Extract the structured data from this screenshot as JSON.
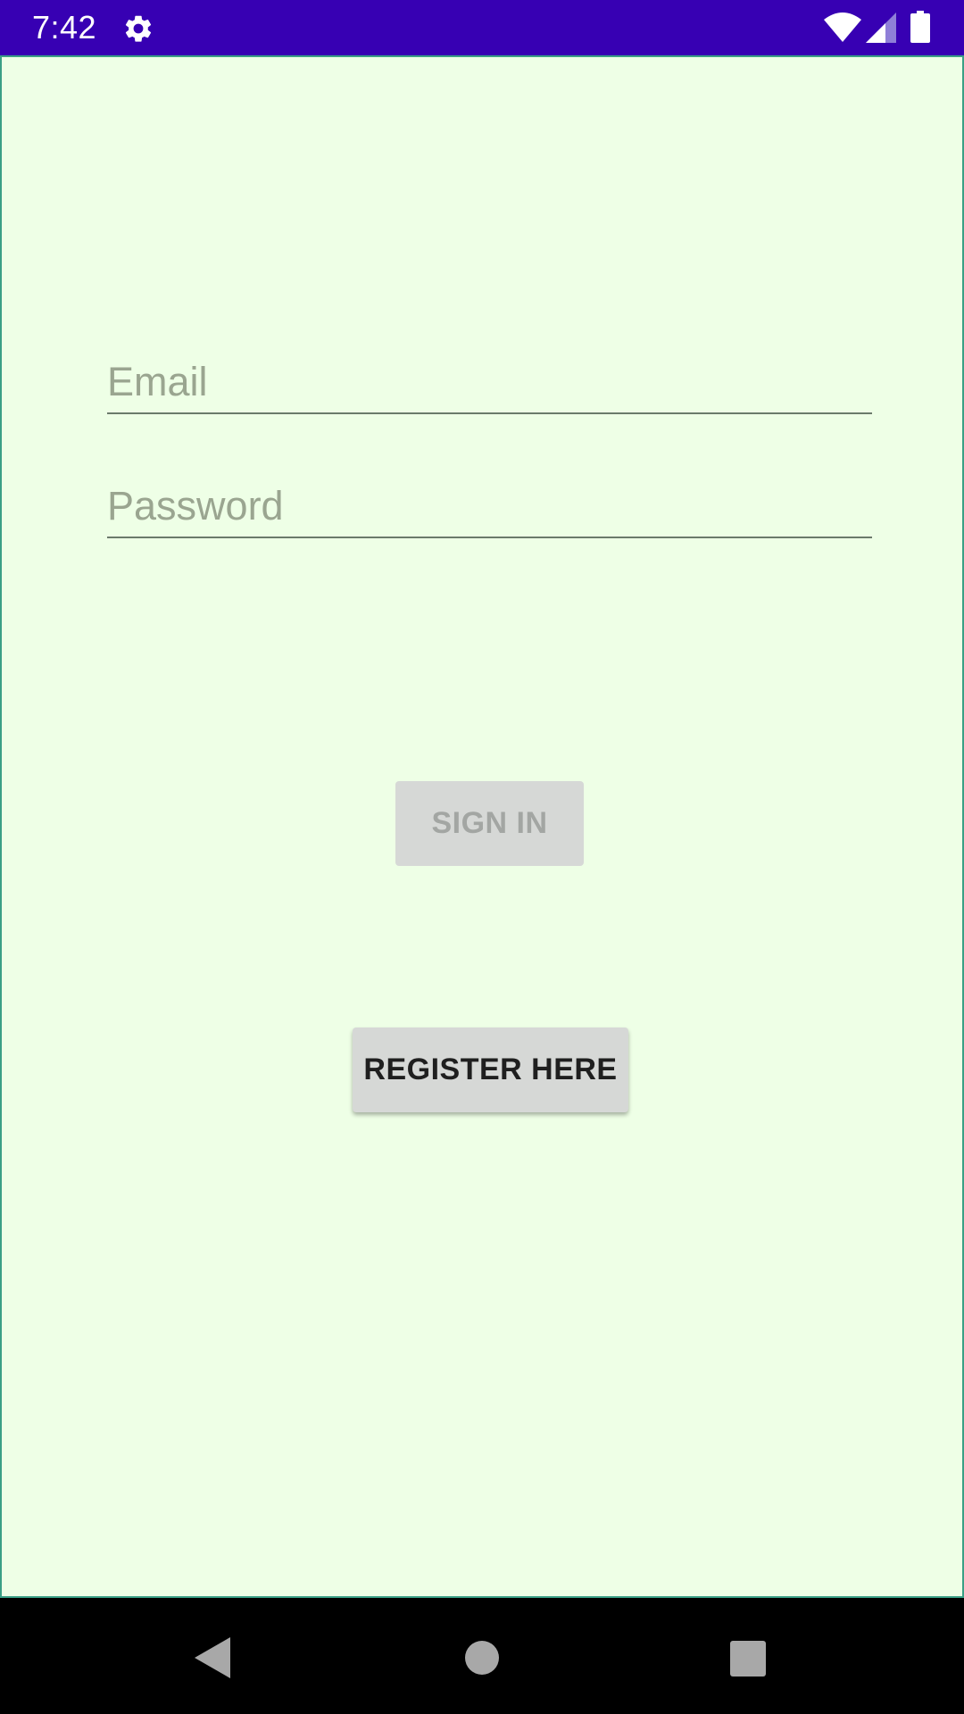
{
  "status_bar": {
    "time": "7:42",
    "background": "#3700b3",
    "icons": [
      "settings-gear-icon",
      "wifi-icon",
      "cell-signal-icon",
      "battery-icon"
    ]
  },
  "form": {
    "email": {
      "placeholder": "Email",
      "value": ""
    },
    "password": {
      "placeholder": "Password",
      "value": ""
    },
    "sign_in_label": "SIGN IN",
    "sign_in_enabled": false,
    "register_label": "REGISTER HERE"
  },
  "navigation_bar": {
    "icons": [
      "back-icon",
      "home-icon",
      "recents-icon"
    ]
  },
  "colors": {
    "content_background": "#eeffe6",
    "accent_border": "#3a9f85",
    "button_background": "#d6d8d6"
  }
}
